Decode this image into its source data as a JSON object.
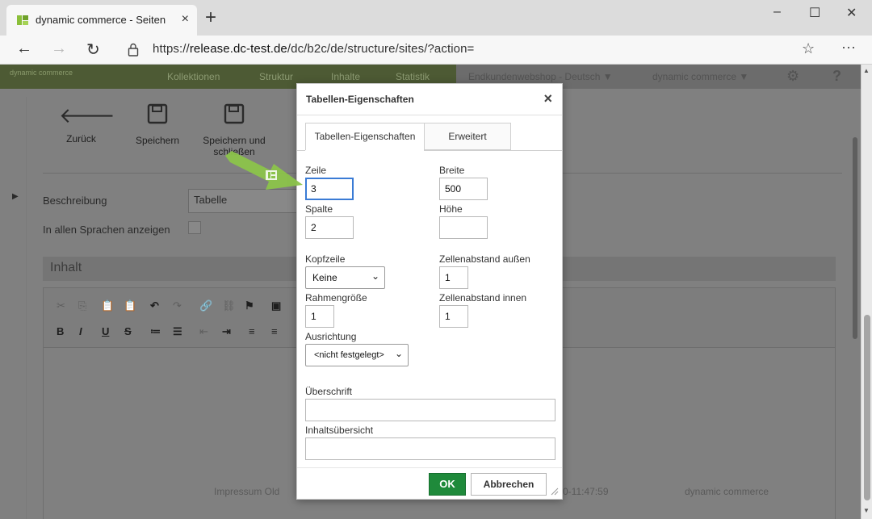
{
  "browser": {
    "tab_title": "dynamic commerce - Seiten",
    "tab_close": "×",
    "new_tab": "+",
    "window_controls": {
      "minimize": "–",
      "maximize": "☐",
      "close": "✕"
    },
    "back": "←",
    "forward": "→",
    "refresh": "↻",
    "url_prefix": "https://",
    "url_host": "release.dc-test.de",
    "url_path": "/dc/b2c/de/structure/sites/?action=",
    "favorite": "☆",
    "more": "···"
  },
  "app": {
    "logo_text": "dynamic commerce",
    "nav": [
      "Kollektionen",
      "Struktur",
      "Inhalte",
      "Statistik"
    ],
    "shop_select": "Endkundenwebshop - Deutsch",
    "company_select": "dynamic commerce",
    "settings_icon": "⚙",
    "help_icon": "?",
    "toolbar": {
      "back_label": "Zurück",
      "save_label": "Speichern",
      "save_close_label": "Speichern und schließen"
    },
    "description_label": "Beschreibung",
    "description_value": "Tabelle",
    "all_languages_label": "In allen Sprachen anzeigen",
    "content_heading": "Inhalt",
    "footer_left": "Impressum Old",
    "footer_mid": "0-11:47:59",
    "footer_right": "dynamic commerce"
  },
  "dialog": {
    "title": "Tabellen-Eigenschaften",
    "close": "×",
    "tabs": [
      {
        "label": "Tabellen-Eigenschaften",
        "active": true
      },
      {
        "label": "Erweitert",
        "active": false
      }
    ],
    "rows_label": "Zeile",
    "rows_value": "3",
    "width_label": "Breite",
    "width_value": "500",
    "cols_label": "Spalte",
    "cols_value": "2",
    "height_label": "Höhe",
    "height_value": "",
    "header_label": "Kopfzeile",
    "header_value": "Keine",
    "cell_spacing_label": "Zellenabstand außen",
    "cell_spacing_value": "1",
    "border_label": "Rahmengröße",
    "border_value": "1",
    "cell_padding_label": "Zellenabstand innen",
    "cell_padding_value": "1",
    "align_label": "Ausrichtung",
    "align_value": "<nicht festgelegt>",
    "caption_label": "Überschrift",
    "caption_value": "",
    "summary_label": "Inhaltsübersicht",
    "summary_value": "",
    "ok_label": "OK",
    "cancel_label": "Abbrechen"
  },
  "colors": {
    "ok_button": "#1f8a3b",
    "focus_border": "#3a7bd5",
    "arrow": "#8bc34a"
  }
}
